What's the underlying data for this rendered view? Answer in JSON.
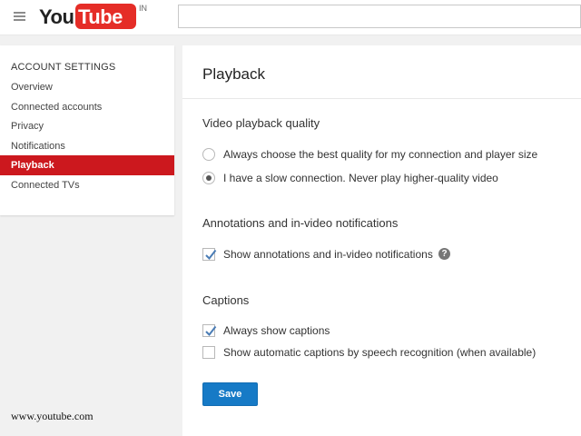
{
  "header": {
    "logo_you": "You",
    "logo_tube": "Tube",
    "region": "IN",
    "search_value": "",
    "search_placeholder": "",
    "menu_icon": "hamburger-menu-icon",
    "brand_color": "#e52d27"
  },
  "sidebar": {
    "heading": "ACCOUNT SETTINGS",
    "items": [
      {
        "label": "Overview",
        "active": false
      },
      {
        "label": "Connected accounts",
        "active": false
      },
      {
        "label": "Privacy",
        "active": false
      },
      {
        "label": "Notifications",
        "active": false
      },
      {
        "label": "Playback",
        "active": true
      },
      {
        "label": "Connected TVs",
        "active": false
      }
    ],
    "active_color": "#cc181e"
  },
  "main": {
    "title": "Playback",
    "sections": {
      "quality": {
        "title": "Video playback quality",
        "options": [
          {
            "label": "Always choose the best quality for my connection and player size",
            "selected": false
          },
          {
            "label": "I have a slow connection. Never play higher-quality video",
            "selected": true
          }
        ]
      },
      "annotations": {
        "title": "Annotations and in-video notifications",
        "options": [
          {
            "label": "Show annotations and in-video notifications",
            "checked": true,
            "help_icon": "question-mark-icon"
          }
        ]
      },
      "captions": {
        "title": "Captions",
        "options": [
          {
            "label": "Always show captions",
            "checked": true
          },
          {
            "label": "Show automatic captions by speech recognition (when available)",
            "checked": false
          }
        ]
      }
    },
    "save_label": "Save",
    "save_color": "#167ac6"
  },
  "watermark": "www.youtube.com"
}
